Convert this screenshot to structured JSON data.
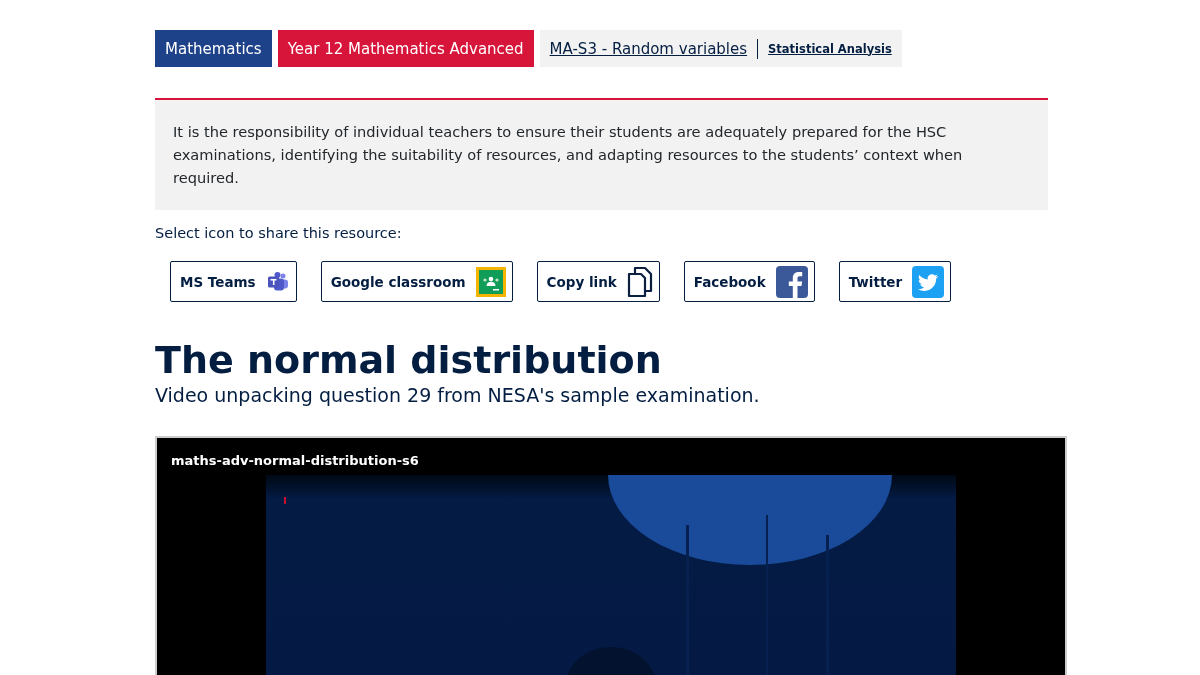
{
  "breadcrumb": [
    {
      "label": "Mathematics",
      "kind": "subject"
    },
    {
      "label": "Year 12 Mathematics Advanced",
      "kind": "course"
    },
    {
      "label": "MA-S3 - Random variables",
      "kind": "link"
    },
    {
      "label": "Statistical Analysis",
      "kind": "sublink"
    }
  ],
  "notice": "It is the responsibility of individual teachers to ensure their students are adequately prepared for the HSC examinations, identifying the suitability of resources, and adapting resources to the students’ context when required.",
  "share": {
    "label": "Select icon to share this resource:",
    "buttons": [
      {
        "label": "MS Teams",
        "kind": "teams"
      },
      {
        "label": "Google classroom",
        "kind": "classroom"
      },
      {
        "label": "Copy link",
        "kind": "copy"
      },
      {
        "label": "Facebook",
        "kind": "facebook"
      },
      {
        "label": "Twitter",
        "kind": "twitter"
      }
    ]
  },
  "heading": "The normal distribution",
  "subtitle": "Video unpacking question 29 from NESA's sample examination.",
  "video": {
    "title": "maths-adv-normal-distribution-s6",
    "kind": "picture"
  }
}
